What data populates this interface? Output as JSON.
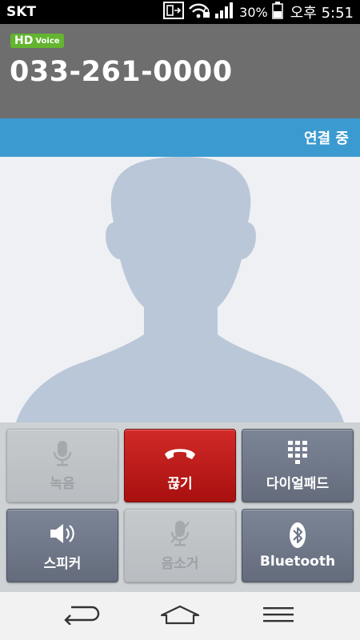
{
  "status_bar": {
    "carrier": "SKT",
    "battery_percent": "30%",
    "time": "오후 5:51",
    "icons": [
      "dual-sim-icon",
      "wifi-lock-icon",
      "signal-icon",
      "battery-icon"
    ]
  },
  "call": {
    "hd_badge_big": "HD",
    "hd_badge_small": "Voice",
    "phone_number": "033-261-0000",
    "status": "연결 중"
  },
  "controls": {
    "record_label": "녹음",
    "end_call_label": "끊기",
    "dialpad_label": "다이얼패드",
    "speaker_label": "스피커",
    "mute_label": "음소거",
    "bluetooth_label": "Bluetooth"
  },
  "colors": {
    "end_call": "#c11b1a",
    "status_strip": "#3b9bd1",
    "hd_badge": "#63b52f",
    "header": "#6e6e6e"
  }
}
